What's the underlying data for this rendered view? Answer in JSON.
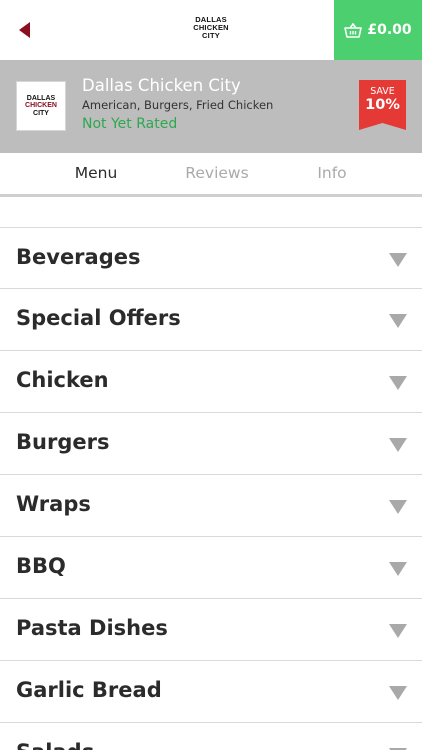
{
  "header": {
    "logo_lines": [
      "DALLAS",
      "CHICKEN",
      "CITY"
    ],
    "cart_total": "£0.00"
  },
  "restaurant": {
    "logo_lines": [
      "DALLAS",
      "CHICKEN",
      "CITY"
    ],
    "name": "Dallas Chicken City",
    "cuisine": "American, Burgers, Fried Chicken",
    "rating": "Not Yet Rated",
    "save_label": "SAVE",
    "save_value": "10%"
  },
  "tabs": [
    {
      "label": "Menu",
      "active": true
    },
    {
      "label": "Reviews",
      "active": false
    },
    {
      "label": "Info",
      "active": false
    }
  ],
  "menu": {
    "categories": [
      {
        "label": "Beverages"
      },
      {
        "label": "Special Offers"
      },
      {
        "label": "Chicken"
      },
      {
        "label": "Burgers"
      },
      {
        "label": "Wraps"
      },
      {
        "label": "BBQ"
      },
      {
        "label": "Pasta Dishes"
      },
      {
        "label": "Garlic Bread"
      },
      {
        "label": "Salads"
      }
    ]
  },
  "colors": {
    "accent_green": "#4ccf6e",
    "back_arrow": "#8a1020",
    "save_badge": "#e53935",
    "rating_text": "#2ea84e"
  },
  "icons": {
    "back": "back-arrow-icon",
    "cart": "basket-icon",
    "expand": "chevron-down-icon"
  }
}
